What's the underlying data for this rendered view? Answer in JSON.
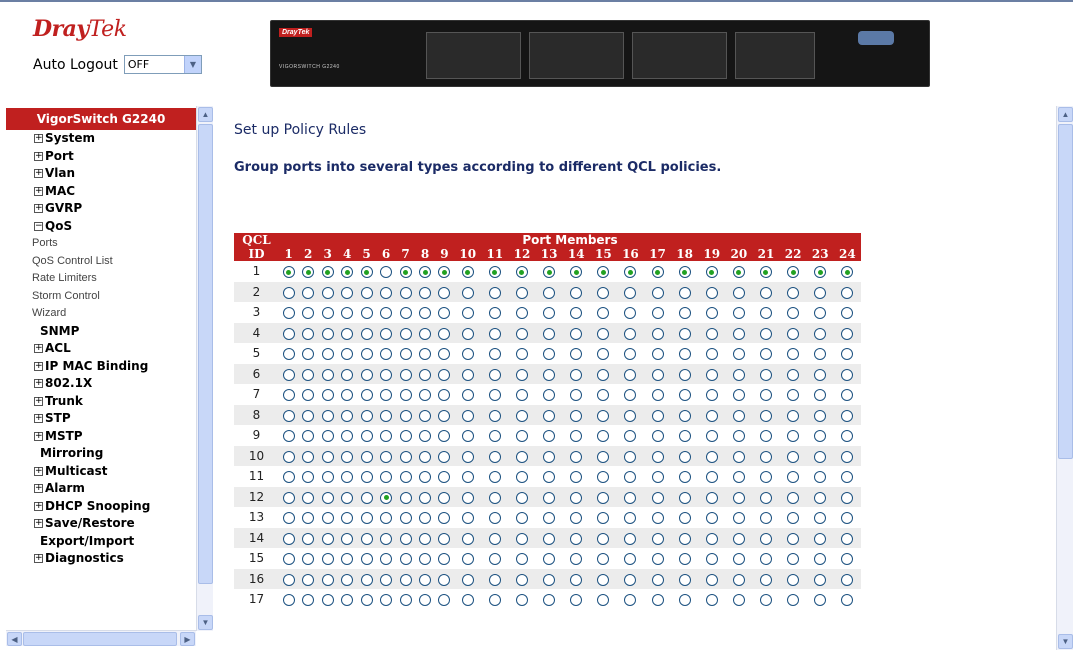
{
  "header": {
    "logo_part1": "Dray",
    "logo_part2": "Tek",
    "auto_logout_label": "Auto Logout",
    "auto_logout_value": "OFF",
    "device_brand": "DrayTek",
    "device_model": "VIGORSWITCH G2240"
  },
  "sidebar": {
    "title": "VigorSwitch G2240",
    "items": [
      {
        "label": "System",
        "type": "collapsed"
      },
      {
        "label": "Port",
        "type": "collapsed"
      },
      {
        "label": "Vlan",
        "type": "collapsed"
      },
      {
        "label": "MAC",
        "type": "collapsed"
      },
      {
        "label": "GVRP",
        "type": "collapsed"
      },
      {
        "label": "QoS",
        "type": "expanded"
      },
      {
        "label": "Ports",
        "type": "sub"
      },
      {
        "label": "QoS Control List",
        "type": "sub"
      },
      {
        "label": "Rate Limiters",
        "type": "sub"
      },
      {
        "label": "Storm Control",
        "type": "sub"
      },
      {
        "label": "Wizard",
        "type": "sub"
      },
      {
        "label": "SNMP",
        "type": "plain"
      },
      {
        "label": "ACL",
        "type": "collapsed"
      },
      {
        "label": "IP MAC Binding",
        "type": "collapsed"
      },
      {
        "label": "802.1X",
        "type": "collapsed"
      },
      {
        "label": "Trunk",
        "type": "collapsed"
      },
      {
        "label": "STP",
        "type": "collapsed"
      },
      {
        "label": "MSTP",
        "type": "collapsed"
      },
      {
        "label": "Mirroring",
        "type": "plain"
      },
      {
        "label": "Multicast",
        "type": "collapsed"
      },
      {
        "label": "Alarm",
        "type": "collapsed"
      },
      {
        "label": "DHCP Snooping",
        "type": "collapsed"
      },
      {
        "label": "Save/Restore",
        "type": "collapsed"
      },
      {
        "label": "Export/Import",
        "type": "plain"
      },
      {
        "label": "Diagnostics",
        "type": "collapsed"
      }
    ]
  },
  "main": {
    "title": "Set up Policy Rules",
    "description": "Group ports into several types according to different QCL policies.",
    "table": {
      "qcl_header": "QCL ID",
      "port_members_header": "Port Members",
      "ports": [
        "1",
        "2",
        "3",
        "4",
        "5",
        "6",
        "7",
        "8",
        "9",
        "10",
        "11",
        "12",
        "13",
        "14",
        "15",
        "16",
        "17",
        "18",
        "19",
        "20",
        "21",
        "22",
        "23",
        "24"
      ],
      "rows": [
        {
          "id": "1",
          "selected_ports": [
            1,
            2,
            3,
            4,
            5,
            7,
            8,
            9,
            10,
            11,
            12,
            13,
            14,
            15,
            16,
            17,
            18,
            19,
            20,
            21,
            22,
            23,
            24
          ]
        },
        {
          "id": "2",
          "selected_ports": []
        },
        {
          "id": "3",
          "selected_ports": []
        },
        {
          "id": "4",
          "selected_ports": []
        },
        {
          "id": "5",
          "selected_ports": []
        },
        {
          "id": "6",
          "selected_ports": []
        },
        {
          "id": "7",
          "selected_ports": []
        },
        {
          "id": "8",
          "selected_ports": []
        },
        {
          "id": "9",
          "selected_ports": []
        },
        {
          "id": "10",
          "selected_ports": []
        },
        {
          "id": "11",
          "selected_ports": []
        },
        {
          "id": "12",
          "selected_ports": [
            6
          ]
        },
        {
          "id": "13",
          "selected_ports": []
        },
        {
          "id": "14",
          "selected_ports": []
        },
        {
          "id": "15",
          "selected_ports": []
        },
        {
          "id": "16",
          "selected_ports": []
        },
        {
          "id": "17",
          "selected_ports": []
        }
      ]
    }
  },
  "colors": {
    "brand_red": "#c0201f",
    "title_blue": "#1b2b66",
    "radio_selected": "#21a121"
  }
}
